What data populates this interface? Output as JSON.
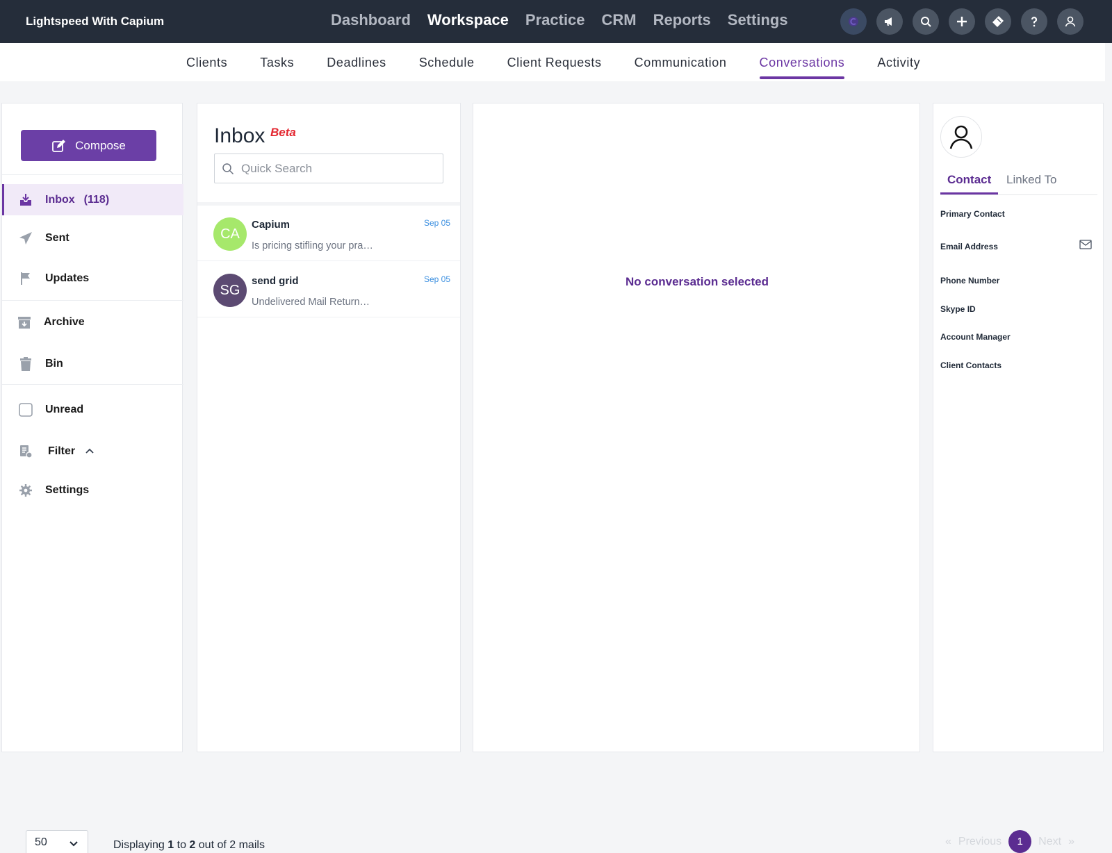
{
  "app": {
    "brand": "Lightspeed With Capium"
  },
  "main_nav": [
    "Dashboard",
    "Workspace",
    "Practice",
    "CRM",
    "Reports",
    "Settings"
  ],
  "main_nav_active": "Workspace",
  "top_icons": [
    "capium-icon",
    "megaphone-icon",
    "search-icon",
    "plus-icon",
    "ticket-icon",
    "help-icon",
    "user-icon"
  ],
  "sub_nav": [
    "Clients",
    "Tasks",
    "Deadlines",
    "Schedule",
    "Client Requests",
    "Communication",
    "Conversations",
    "Activity"
  ],
  "sub_nav_active": "Conversations",
  "sidebar": {
    "compose_label": "Compose",
    "items": [
      {
        "label": "Inbox",
        "count": "(118)",
        "icon": "inbox-icon"
      },
      {
        "label": "Sent",
        "icon": "send-icon"
      },
      {
        "label": "Updates",
        "icon": "flag-icon"
      },
      {
        "label": "Archive",
        "icon": "archive-icon"
      },
      {
        "label": "Bin",
        "icon": "trash-icon"
      },
      {
        "label": "Unread",
        "icon": "checkbox"
      },
      {
        "label": "Filter",
        "icon": "filter-icon"
      },
      {
        "label": "Settings",
        "icon": "gear-icon"
      }
    ]
  },
  "inbox": {
    "title": "Inbox",
    "beta": "Beta",
    "search_placeholder": "Quick Search",
    "mails": [
      {
        "initials": "CA",
        "sender": "Capium",
        "snippet": "Is pricing stifling your pra…",
        "date": "Sep 05",
        "color": "#a6e86b"
      },
      {
        "initials": "SG",
        "sender": "send grid",
        "snippet": "Undelivered Mail Return…",
        "date": "Sep 05",
        "color": "#5c4a72"
      }
    ]
  },
  "center": {
    "empty_text": "No conversation selected"
  },
  "contact_panel": {
    "tabs": [
      "Contact",
      "Linked To"
    ],
    "fields": [
      "Primary Contact",
      "Email Address",
      "Phone Number",
      "Skype ID",
      "Account Manager",
      "Client Contacts"
    ]
  },
  "footer": {
    "per_page": "50",
    "displaying": {
      "prefix": "Displaying",
      "from": "1",
      "to_word": "to",
      "to": "2",
      "suffix": "out of 2 mails"
    },
    "pager": {
      "first": "«",
      "previous": "Previous",
      "page": "1",
      "next": "Next",
      "last": "»"
    }
  },
  "colors": {
    "accent": "#6b36a3",
    "topbar": "#252d3a",
    "beta": "#e3262f",
    "date": "#3b8fe0"
  }
}
